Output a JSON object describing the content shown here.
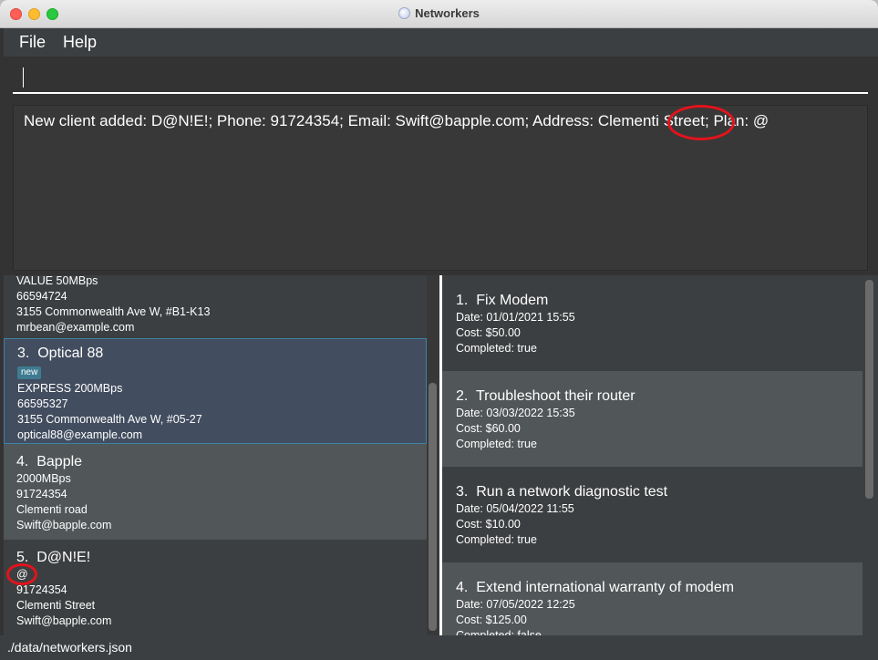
{
  "window": {
    "title": "Networkers"
  },
  "menu": {
    "file": "File",
    "help": "Help"
  },
  "command": {
    "value": ""
  },
  "result": {
    "text": "New client added: D@N!E!; Phone: 91724354; Email: Swift@bapple.com; Address: Clementi Street; Plan: @"
  },
  "clients": [
    {
      "index": "",
      "name": "",
      "tag": "",
      "plan": "VALUE 50MBps",
      "phone": "66594724",
      "address": "3155 Commonwealth Ave W, #B1-K13",
      "email": "mrbean@example.com"
    },
    {
      "index": "3.",
      "name": "Optical 88",
      "tag": "new",
      "plan": "EXPRESS 200MBps",
      "phone": "66595327",
      "address": "3155 Commonwealth Ave W, #05-27",
      "email": "optical88@example.com"
    },
    {
      "index": "4.",
      "name": "Bapple",
      "tag": "",
      "plan": "2000MBps",
      "phone": "91724354",
      "address": "Clementi road",
      "email": "Swift@bapple.com"
    },
    {
      "index": "5.",
      "name": "D@N!E!",
      "tag": "",
      "plan": "@",
      "phone": "91724354",
      "address": "Clementi Street",
      "email": "Swift@bapple.com"
    }
  ],
  "tasks": [
    {
      "index": "1.",
      "name": "Fix Modem",
      "date": "Date: 01/01/2021 15:55",
      "cost": "Cost: $50.00",
      "completed": "Completed: true"
    },
    {
      "index": "2.",
      "name": "Troubleshoot their router",
      "date": "Date: 03/03/2022 15:35",
      "cost": "Cost: $60.00",
      "completed": "Completed: true"
    },
    {
      "index": "3.",
      "name": "Run a network diagnostic test",
      "date": "Date: 05/04/2022 11:55",
      "cost": "Cost: $10.00",
      "completed": "Completed: true"
    },
    {
      "index": "4.",
      "name": "Extend international warranty of modem",
      "date": "Date: 07/05/2022 12:25",
      "cost": "Cost: $125.00",
      "completed": "Completed: false"
    }
  ],
  "status": {
    "path": "./data/networkers.json"
  },
  "colors": {
    "annotation": "#e3131b",
    "selected_border": "#3d82a5",
    "tag_bg": "#3e7b91"
  }
}
